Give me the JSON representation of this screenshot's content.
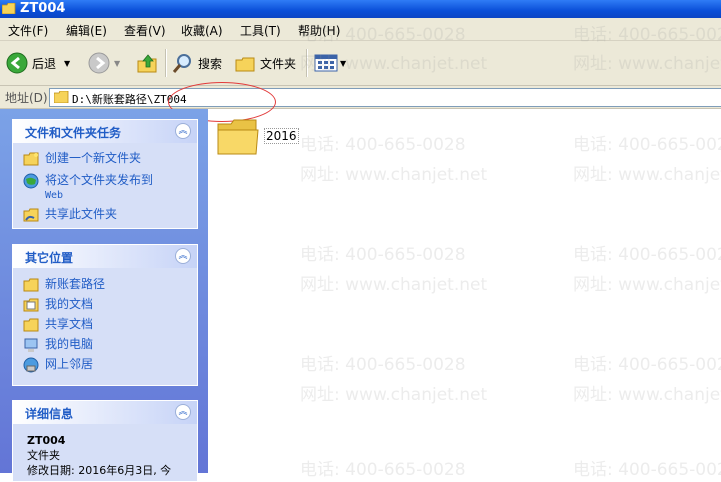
{
  "window": {
    "title": "ZT004"
  },
  "menu": [
    "文件(F)",
    "编辑(E)",
    "查看(V)",
    "收藏(A)",
    "工具(T)",
    "帮助(H)"
  ],
  "toolbar": {
    "back_label": "后退",
    "search_label": "搜索",
    "folders_label": "文件夹"
  },
  "address": {
    "label": "地址(D)",
    "path": "D:\\新账套路径\\ZT004"
  },
  "tasks": {
    "title": "文件和文件夹任务",
    "items": [
      "创建一个新文件夹",
      "将这个文件夹发布到",
      "Web",
      "共享此文件夹"
    ]
  },
  "places": {
    "title": "其它位置",
    "items": [
      "新账套路径",
      "我的文档",
      "共享文档",
      "我的电脑",
      "网上邻居"
    ]
  },
  "details": {
    "title": "详细信息",
    "name": "ZT004",
    "type": "文件夹",
    "modified": "修改日期: 2016年6月3日, 今"
  },
  "content": {
    "folder_name": "2016"
  },
  "watermark": {
    "phone": "电话: 400-665-0028",
    "site": "网址: www.chanjet.net"
  },
  "colors": {
    "titlebar": "#0a4fd8",
    "pane": "#6375d6",
    "link": "#215dc6",
    "annotation": "#e23b3b"
  }
}
